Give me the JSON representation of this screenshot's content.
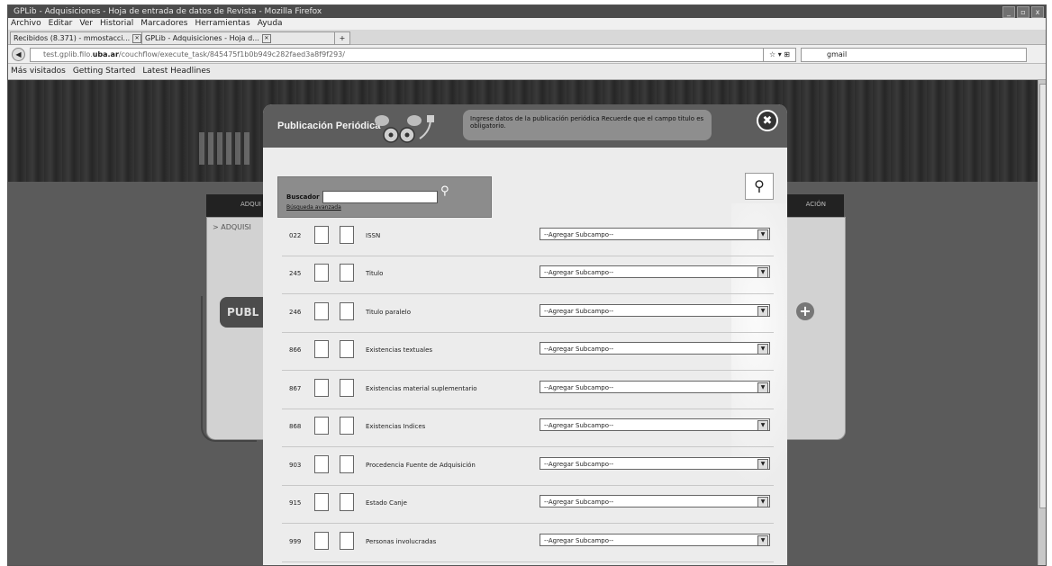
{
  "window": {
    "title": "GPLib - Adquisiciones - Hoja de entrada de datos de Revista - Mozilla Firefox",
    "buttons": [
      "_",
      "▫",
      "x"
    ]
  },
  "menu": [
    "Archivo",
    "Editar",
    "Ver",
    "Historial",
    "Marcadores",
    "Herramientas",
    "Ayuda"
  ],
  "tabs": [
    {
      "label": "Recibidos (8.371) - mmostacci..."
    },
    {
      "label": "GPLib - Adquisiciones - Hoja d..."
    }
  ],
  "urlbar": {
    "prefix": "test.gplib.filo.",
    "domain": "uba.ar",
    "path": "/couchflow/execute_task/845475f1b0b949c282faed3a8f9f293/",
    "search_engine_label": "gmail"
  },
  "bookmarks": [
    "Más visitados",
    "Getting Started",
    "Latest Headlines"
  ],
  "site": {
    "nav_left": "ADQUI",
    "nav_right": "ACIÓN",
    "breadcrumb": "> ADQUISI",
    "publ_button": "PUBL"
  },
  "modal": {
    "title": "Publicación Periódica",
    "hint": "Ingrese datos de la publicación periódica Recuerde que el campo titulo es obligatorio.",
    "close_symbol": "✖",
    "search_label": "Buscador",
    "advanced_search": "Búsqueda avanzada",
    "fields": [
      {
        "tag": "022",
        "name": "ISSN",
        "select": "--Agregar Subcampo--"
      },
      {
        "tag": "245",
        "name": "Titulo",
        "select": "--Agregar Subcampo--"
      },
      {
        "tag": "246",
        "name": "Titulo paralelo",
        "select": "--Agregar Subcampo--"
      },
      {
        "tag": "866",
        "name": "Existencias textuales",
        "select": "--Agregar Subcampo--"
      },
      {
        "tag": "867",
        "name": "Existencias material suplementario",
        "select": "--Agregar Subcampo--"
      },
      {
        "tag": "868",
        "name": "Existencias Indices",
        "select": "--Agregar Subcampo--"
      },
      {
        "tag": "903",
        "name": "Procedencia Fuente de Adquisición",
        "select": "--Agregar Subcampo--"
      },
      {
        "tag": "915",
        "name": "Estado Canje",
        "select": "--Agregar Subcampo--"
      },
      {
        "tag": "999",
        "name": "Personas involucradas",
        "select": "--Agregar Subcampo--"
      }
    ]
  }
}
